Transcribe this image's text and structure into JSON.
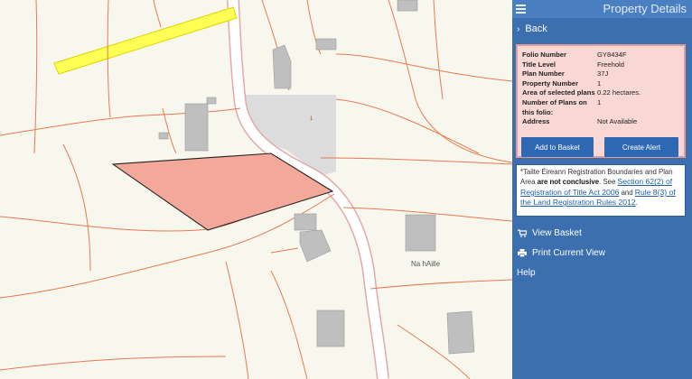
{
  "header": {
    "title": "Property Details",
    "menu_icon": "hamburger-menu-icon"
  },
  "nav": {
    "back_label": "Back"
  },
  "property": {
    "rows": [
      {
        "label": "Folio Number",
        "value": "GY8434F"
      },
      {
        "label": "Title Level",
        "value": "Freehold"
      },
      {
        "label": "Plan Number",
        "value": "37J"
      },
      {
        "label": "Property Number",
        "value": "1"
      },
      {
        "label": "Area of selected plans",
        "value": "0.22 hectares."
      },
      {
        "label": "Number of Plans on this folio:",
        "value": "1"
      },
      {
        "label": "Address",
        "value": "Not Available"
      }
    ],
    "add_to_basket_label": "Add to Basket",
    "create_alert_label": "Create Alert"
  },
  "notice": {
    "lead": "*Tailte Éireann Registration Boundaries and Plan Area ",
    "emphasis": "are not conclusive",
    "mid": ". See ",
    "link1": "Section 62(2) of Registration of Title Act 2006",
    "joiner": " and ",
    "link2": "Rule 8(3) of the Land Registration Rules 2012",
    "tail": "."
  },
  "menu": {
    "view_basket": "View Basket",
    "print_view": "Print Current View",
    "help": "Help"
  },
  "map": {
    "place_label": "Na hAille",
    "plan_marker": "1",
    "colors": {
      "background": "#f7f7ee",
      "boundary": "#e87a4e",
      "selected_plan_fill": "#f4a89a",
      "highlight_road": "#ffff55",
      "building": "#bfbfbf",
      "panel": "#3b6fb0"
    }
  }
}
